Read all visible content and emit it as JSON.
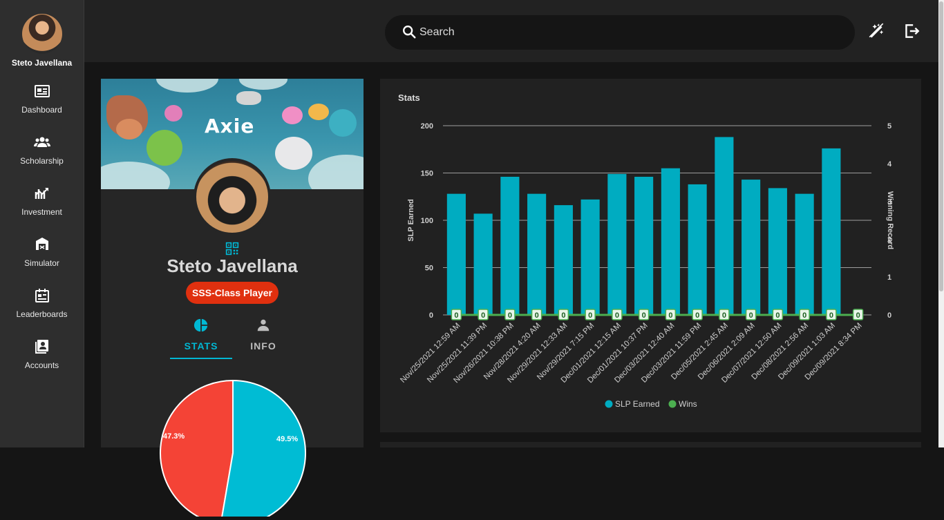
{
  "sidebar": {
    "user_name": "Steto Javellana",
    "items": [
      {
        "label": "Dashboard",
        "icon": "dashboard-icon"
      },
      {
        "label": "Scholarship",
        "icon": "people-icon"
      },
      {
        "label": "Investment",
        "icon": "investment-icon"
      },
      {
        "label": "Simulator",
        "icon": "simulator-icon"
      },
      {
        "label": "Leaderboards",
        "icon": "leaderboard-icon"
      },
      {
        "label": "Accounts",
        "icon": "accounts-icon"
      }
    ]
  },
  "topbar": {
    "search_placeholder": "Search",
    "actions": [
      "theme-toggle-icon",
      "logout-icon"
    ]
  },
  "profile_card": {
    "banner_logo": "Axie",
    "player_name": "Steto Javellana",
    "rank_badge": "SSS-Class Player",
    "tabs": [
      {
        "label": "STATS",
        "icon": "pie-chart-icon",
        "active": true
      },
      {
        "label": "INFO",
        "icon": "person-icon",
        "active": false
      }
    ],
    "pie": {
      "slices": [
        {
          "label": "47.3%",
          "value": 47.3,
          "color": "#f44336"
        },
        {
          "label": "49.5%",
          "value": 49.5,
          "color": "#00bcd4"
        }
      ]
    }
  },
  "stats_card": {
    "title": "Stats"
  },
  "colors": {
    "accent": "#00b8d4",
    "bar": "#00acc1",
    "wins": "#4caf50",
    "badge": "#e0300f",
    "sidebar_bg": "#2e2e2e"
  },
  "chart_data": {
    "type": "bar",
    "title": "Stats",
    "categories": [
      "Nov/25/2021 12:59 AM",
      "Nov/25/2021 11:39 PM",
      "Nov/26/2021 10:38 PM",
      "Nov/28/2021 4:20 AM",
      "Nov/29/2021 12:33 AM",
      "Nov/29/2021 7:15 PM",
      "Dec/01/2021 12:15 AM",
      "Dec/01/2021 10:37 PM",
      "Dec/03/2021 12:40 AM",
      "Dec/03/2021 11:59 PM",
      "Dec/05/2021 2:45 AM",
      "Dec/06/2021 2:09 AM",
      "Dec/07/2021 12:50 AM",
      "Dec/08/2021 2:56 AM",
      "Dec/09/2021 1:03 AM",
      "Dec/09/2021 8:34 PM"
    ],
    "series": [
      {
        "name": "SLP Earned",
        "type": "bar",
        "axis": "left",
        "color": "#00acc1",
        "values": [
          128,
          107,
          146,
          128,
          116,
          122,
          149,
          146,
          155,
          138,
          188,
          143,
          134,
          128,
          176,
          0
        ]
      },
      {
        "name": "Wins",
        "type": "line",
        "axis": "right",
        "color": "#4caf50",
        "values": [
          0,
          0,
          0,
          0,
          0,
          0,
          0,
          0,
          0,
          0,
          0,
          0,
          0,
          0,
          0,
          0
        ]
      }
    ],
    "ylabel": "SLP Earned",
    "y2label": "Winning Record",
    "ylim": [
      0,
      200
    ],
    "y2lim": [
      0,
      5
    ],
    "yticks": [
      0,
      50,
      100,
      150,
      200
    ],
    "y2ticks": [
      0,
      1,
      2,
      3,
      4,
      5
    ],
    "data_labels": [
      "0",
      "0",
      "0",
      "0",
      "0",
      "0",
      "0",
      "0",
      "0",
      "0",
      "0",
      "0",
      "0",
      "0",
      "0",
      "0"
    ],
    "grid": true,
    "legend": "bottom"
  }
}
